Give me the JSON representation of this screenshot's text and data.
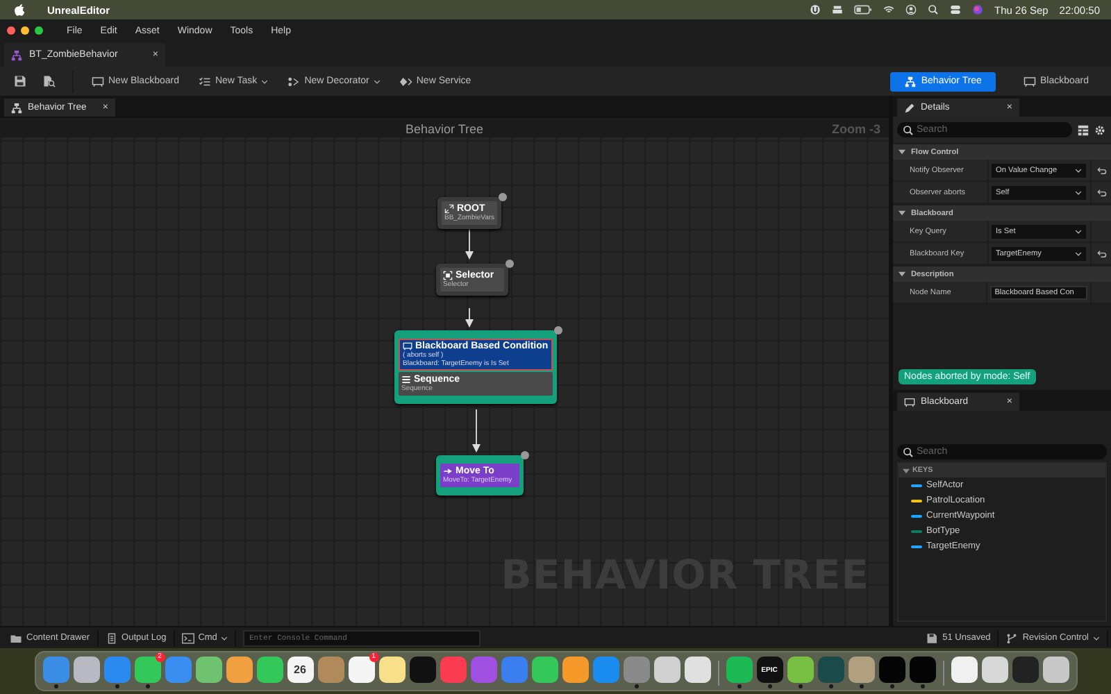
{
  "menubar": {
    "app": "UnrealEditor",
    "date": "Thu 26 Sep",
    "time": "22:00:50"
  },
  "window": {
    "menus": [
      "File",
      "Edit",
      "Asset",
      "Window",
      "Tools",
      "Help"
    ],
    "document_tab": {
      "label": "BT_ZombieBehavior",
      "close": "×"
    }
  },
  "toolbar": {
    "items": [
      {
        "kind": "blackboard",
        "label": "New Blackboard",
        "dropdown": false
      },
      {
        "kind": "task",
        "label": "New Task",
        "dropdown": true
      },
      {
        "kind": "decorator",
        "label": "New Decorator",
        "dropdown": true
      },
      {
        "kind": "service",
        "label": "New Service",
        "dropdown": false
      }
    ],
    "modes": [
      {
        "kind": "tree",
        "label": "Behavior Tree",
        "selected": true
      },
      {
        "kind": "blackboard",
        "label": "Blackboard",
        "selected": false
      }
    ]
  },
  "graph": {
    "tab": {
      "label": "Behavior Tree",
      "close": "×"
    },
    "header": "Behavior Tree",
    "zoom": "Zoom -3",
    "watermark": "BEHAVIOR TREE",
    "nodes": [
      {
        "kind": "root",
        "title": "ROOT",
        "subtitle": "BB_ZombieVars",
        "highlighted": false
      },
      {
        "kind": "selector",
        "title": "Selector",
        "subtitle": "Selector",
        "highlighted": false
      },
      {
        "kind": "sequence",
        "title": "Sequence",
        "subtitle": "Sequence",
        "highlighted": true,
        "decorators": [
          {
            "title": "Blackboard Based Condition",
            "lines": [
              "( aborts self )",
              "Blackboard: TargetEnemy is Is Set"
            ],
            "selected": true
          }
        ]
      },
      {
        "kind": "task",
        "title": "Move To",
        "subtitle": "MoveTo: TargetEnemy",
        "highlighted": true
      }
    ]
  },
  "details": {
    "tab": {
      "label": "Details",
      "close": "×"
    },
    "search": {
      "placeholder": "Search"
    },
    "sections": [
      {
        "title": "Flow Control",
        "expanded": true,
        "rows": [
          {
            "label": "Notify Observer",
            "kind": "dropdown",
            "value": "On Value Change",
            "reset": true
          },
          {
            "label": "Observer aborts",
            "kind": "dropdown",
            "value": "Self",
            "reset": true
          }
        ]
      },
      {
        "title": "Blackboard",
        "expanded": true,
        "rows": [
          {
            "label": "Key Query",
            "kind": "dropdown",
            "value": "Is Set",
            "reset": false
          },
          {
            "label": "Blackboard Key",
            "kind": "dropdown",
            "value": "TargetEnemy",
            "reset": true
          }
        ]
      },
      {
        "title": "Description",
        "expanded": true,
        "rows": [
          {
            "label": "Node Name",
            "kind": "text",
            "value": "Blackboard Based Con",
            "reset": false
          }
        ]
      }
    ]
  },
  "notice": "Nodes aborted by mode: Self",
  "blackboard": {
    "tab": {
      "label": "Blackboard",
      "close": "×"
    },
    "search": {
      "placeholder": "Search"
    },
    "keys_header": "KEYS",
    "keys": [
      {
        "name": "SelfActor",
        "color": "#1ea7ff"
      },
      {
        "name": "PatrolLocation",
        "color": "#f2c21b"
      },
      {
        "name": "CurrentWaypoint",
        "color": "#1ea7ff"
      },
      {
        "name": "BotType",
        "color": "#0d7a62"
      },
      {
        "name": "TargetEnemy",
        "color": "#1ea7ff"
      }
    ]
  },
  "status_bar": {
    "left": [
      {
        "kind": "drawer",
        "label": "Content Drawer",
        "dropdown": false
      },
      {
        "kind": "log",
        "label": "Output Log",
        "dropdown": false
      },
      {
        "kind": "cmd",
        "label": "Cmd",
        "dropdown": true
      }
    ],
    "console": {
      "placeholder": "Enter Console Command"
    },
    "right": [
      {
        "kind": "unsaved",
        "label": "51 Unsaved",
        "dropdown": false
      },
      {
        "kind": "revision",
        "label": "Revision Control",
        "dropdown": true
      }
    ]
  },
  "dock": {
    "apps": [
      {
        "color": "#3a8ee6",
        "running": true
      },
      {
        "color": "#b9b9c4",
        "running": false
      },
      {
        "color": "#2a8af0",
        "running": true
      },
      {
        "color": "#34c759",
        "badge": "2",
        "running": true
      },
      {
        "color": "#3a8ef0",
        "running": false
      },
      {
        "color": "#6fc26f",
        "running": false
      },
      {
        "color": "#f0a040",
        "running": false
      },
      {
        "color": "#34c759",
        "running": false
      },
      {
        "color": "#f4f4f4",
        "label": "26",
        "running": false
      },
      {
        "color": "#b08a5a",
        "running": false
      },
      {
        "color": "#f5f5f5",
        "badge": "1",
        "running": false
      },
      {
        "color": "#f8e08a",
        "running": false
      },
      {
        "color": "#111111",
        "running": false
      },
      {
        "color": "#fa3c50",
        "running": false
      },
      {
        "color": "#a050e0",
        "running": false
      },
      {
        "color": "#3a7ef0",
        "running": false
      },
      {
        "color": "#34c759",
        "running": false
      },
      {
        "color": "#f59a2a",
        "running": false
      },
      {
        "color": "#1a8cf0",
        "running": false
      },
      {
        "color": "#8a8a8a",
        "running": true
      },
      {
        "color": "#d0d0d0",
        "running": false
      },
      {
        "color": "#e0e0e0",
        "running": false
      },
      {
        "color": "#1db954",
        "running": true,
        "separator": true
      },
      {
        "color": "#111111",
        "label": "EPIC",
        "running": true
      },
      {
        "color": "#77c043",
        "running": true
      },
      {
        "color": "#1a4a4a",
        "running": true
      },
      {
        "color": "#b0a080",
        "running": true
      },
      {
        "color": "#050505",
        "running": true
      },
      {
        "color": "#050505",
        "running": true
      },
      {
        "color": "#f0f0f0",
        "running": false,
        "separator": true
      },
      {
        "color": "#d8d8d8",
        "running": false
      },
      {
        "color": "#222222",
        "running": false
      },
      {
        "color": "#c8c8c8",
        "running": false
      }
    ]
  }
}
